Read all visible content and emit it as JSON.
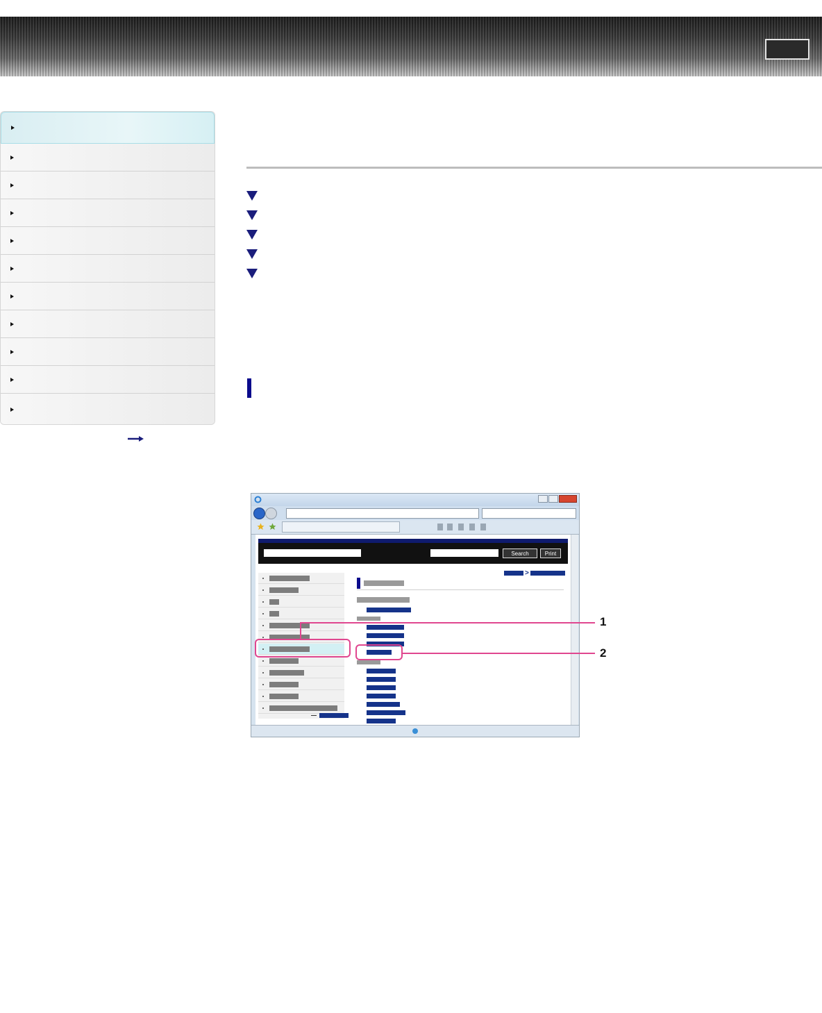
{
  "header": {
    "button_label": ""
  },
  "sidebar": {
    "items": [
      {
        "label": ""
      },
      {
        "label": ""
      },
      {
        "label": ""
      },
      {
        "label": ""
      },
      {
        "label": ""
      },
      {
        "label": ""
      },
      {
        "label": ""
      },
      {
        "label": ""
      },
      {
        "label": ""
      },
      {
        "label": ""
      },
      {
        "label": ""
      }
    ],
    "more_link": ""
  },
  "main": {
    "toc": [
      {
        "label": ""
      },
      {
        "label": ""
      },
      {
        "label": ""
      },
      {
        "label": ""
      },
      {
        "label": ""
      }
    ]
  },
  "illustration": {
    "site_buttons": {
      "search": "Search",
      "print": "Print"
    },
    "callouts": [
      "1",
      "2"
    ]
  },
  "colors": {
    "accent_blue": "#1a1d7c",
    "highlight_pink": "#e0468f",
    "sidebar_active": "#d9eef2"
  }
}
